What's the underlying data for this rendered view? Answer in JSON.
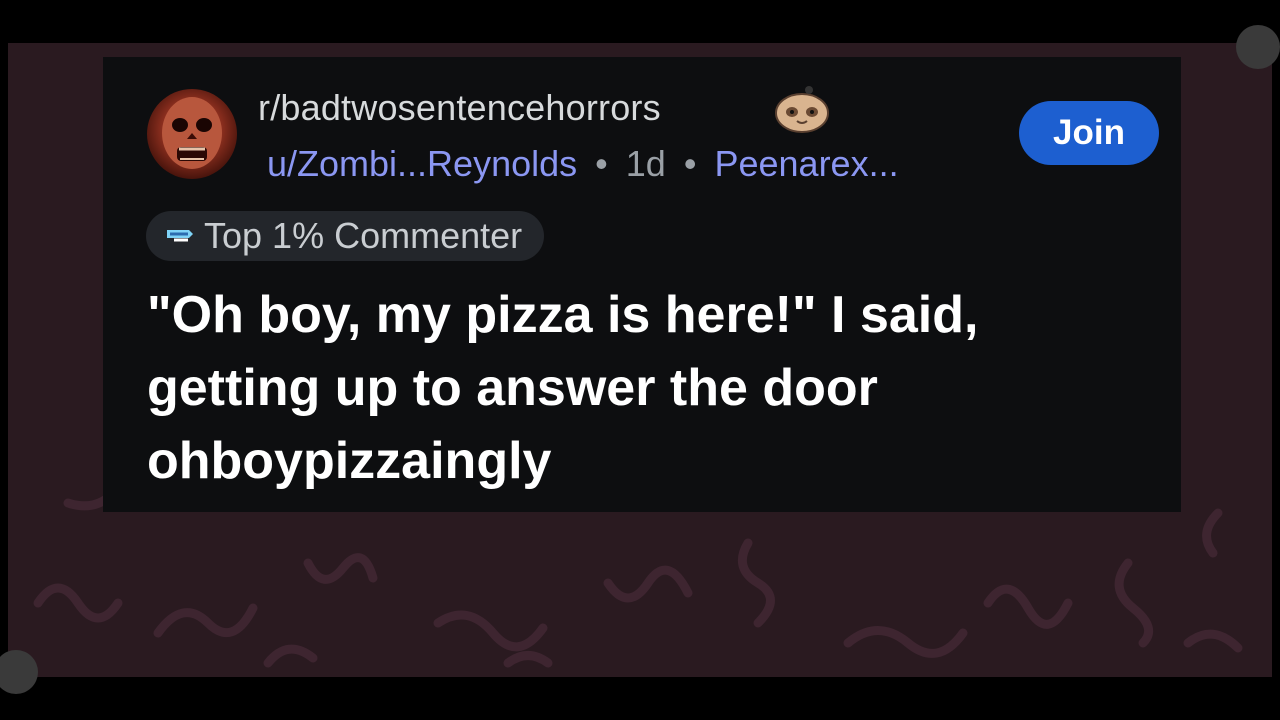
{
  "post": {
    "subreddit": "r/badtwosentencehorrors",
    "username": "u/Zombi...Reynolds",
    "age": "1d",
    "flair": "Peenarex...",
    "join_label": "Join",
    "badge_label": "Top 1% Commenter",
    "body": "\"Oh boy, my pizza is here!\" I said,\ngetting up to answer the door\nohboypizzaingly"
  },
  "icons": {
    "avatar": "zombie-avatar",
    "subreddit_emoji": "sloth-icon",
    "badge": "top-commenter-icon"
  },
  "colors": {
    "card_bg": "#0d0e10",
    "join_bg": "#1d5fd0",
    "link": "#8b97f2",
    "backdrop": "#2a1a20"
  }
}
